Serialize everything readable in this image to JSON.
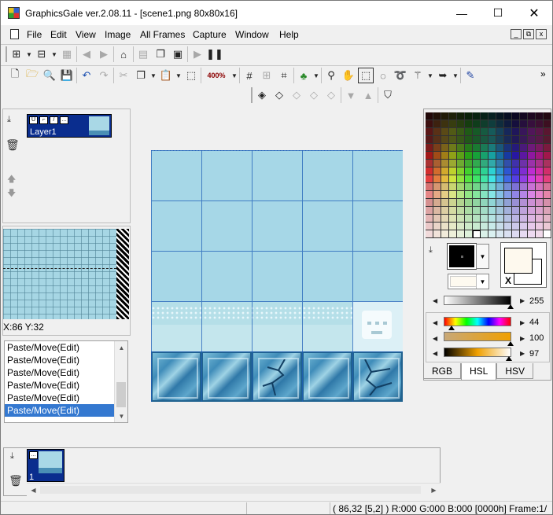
{
  "window": {
    "title": "GraphicsGale ver.2.08.11 - [scene1.png 80x80x16]",
    "min_glyph": "—",
    "max_glyph": "☐",
    "close_glyph": "✕"
  },
  "menu": {
    "items": [
      "File",
      "Edit",
      "View",
      "Image",
      "All Frames",
      "Capture",
      "Window",
      "Help"
    ],
    "mdi": [
      "_",
      "⧉",
      "x"
    ]
  },
  "toolbar": {
    "zoom_label": "400%"
  },
  "layers": {
    "name": "Layer1"
  },
  "navigator": {
    "coords": "X:86 Y:32"
  },
  "history": {
    "items": [
      "Paste/Move(Edit)",
      "Paste/Move(Edit)",
      "Paste/Move(Edit)",
      "Paste/Move(Edit)",
      "Paste/Move(Edit)",
      "Paste/Move(Edit)"
    ],
    "selected_index": 5
  },
  "color_panel": {
    "slider_top_value": "255",
    "h_value": "44",
    "s_value": "100",
    "l_value": "97",
    "tabs": [
      "RGB",
      "HSL",
      "HSV"
    ],
    "active_tab": "HSL",
    "fg_color": "#000000",
    "bg_color": "#fef9ee",
    "bg_x_label": "X"
  },
  "frames": {
    "frame_number": "1"
  },
  "statusbar": {
    "text": "( 86,32 [5,2] ) R:000 G:000 B:000  [0000h]  Frame:1/"
  },
  "colors": {
    "canvas_sky": "#a6d7e7",
    "grid_line": "#1f5fb8",
    "selection": "#3478d0",
    "layer_bg": "#0a2d8e"
  }
}
